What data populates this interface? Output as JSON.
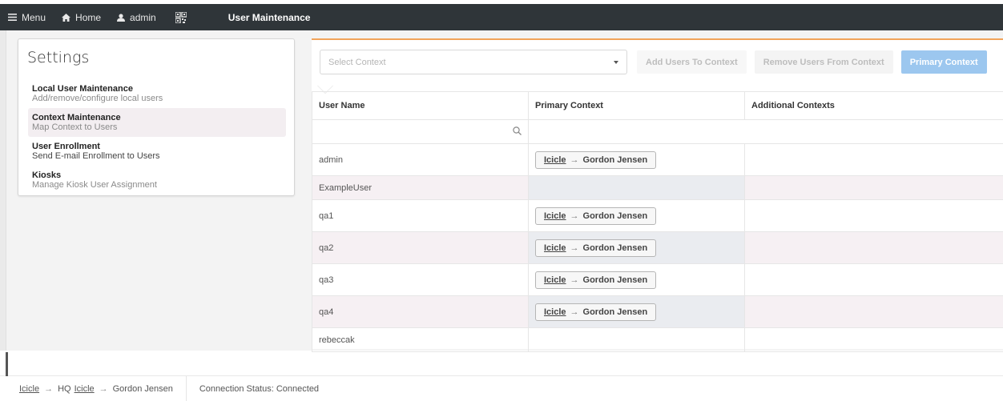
{
  "topbar": {
    "menu_label": "Menu",
    "home_label": "Home",
    "user_label": "admin",
    "page_title": "User Maintenance"
  },
  "settings": {
    "title": "Settings",
    "items": [
      {
        "title": "Local User Maintenance",
        "desc": "Add/remove/configure local users"
      },
      {
        "title": "Context Maintenance",
        "desc": "Map Context to Users"
      },
      {
        "title": "User Enrollment",
        "desc": "Send E-mail Enrollment to Users"
      },
      {
        "title": "Kiosks",
        "desc": "Manage Kiosk User Assignment"
      }
    ]
  },
  "toolbar": {
    "select_placeholder": "Select Context",
    "add_label": "Add Users To Context",
    "remove_label": "Remove Users From Context",
    "primary_label": "Primary Context"
  },
  "table": {
    "headers": [
      "User Name",
      "Primary Context",
      "Additional Contexts"
    ],
    "rows": [
      {
        "user": "admin",
        "ctx_from": "Icicle",
        "ctx_to": "Gordon Jensen"
      },
      {
        "user": "ExampleUser",
        "ctx_from": "",
        "ctx_to": ""
      },
      {
        "user": "qa1",
        "ctx_from": "Icicle",
        "ctx_to": "Gordon Jensen"
      },
      {
        "user": "qa2",
        "ctx_from": "Icicle",
        "ctx_to": "Gordon Jensen"
      },
      {
        "user": "qa3",
        "ctx_from": "Icicle",
        "ctx_to": "Gordon Jensen"
      },
      {
        "user": "qa4",
        "ctx_from": "Icicle",
        "ctx_to": "Gordon Jensen"
      },
      {
        "user": "rebeccak",
        "ctx_from": "",
        "ctx_to": ""
      }
    ]
  },
  "footer": {
    "crumb_1": "Icicle",
    "crumb_2_prefix": "HQ",
    "crumb_2": "Icicle",
    "crumb_3": "Gordon Jensen",
    "connection": "Connection Status: Connected"
  },
  "colors": {
    "topbar": "#2f3539",
    "accent_orange": "#f2a35a",
    "primary_button": "#9cc7ef"
  },
  "icons": [
    "hamburger-icon",
    "home-icon",
    "user-icon",
    "qr-code-icon",
    "search-icon",
    "arrow-right-icon",
    "caret-down-icon"
  ]
}
